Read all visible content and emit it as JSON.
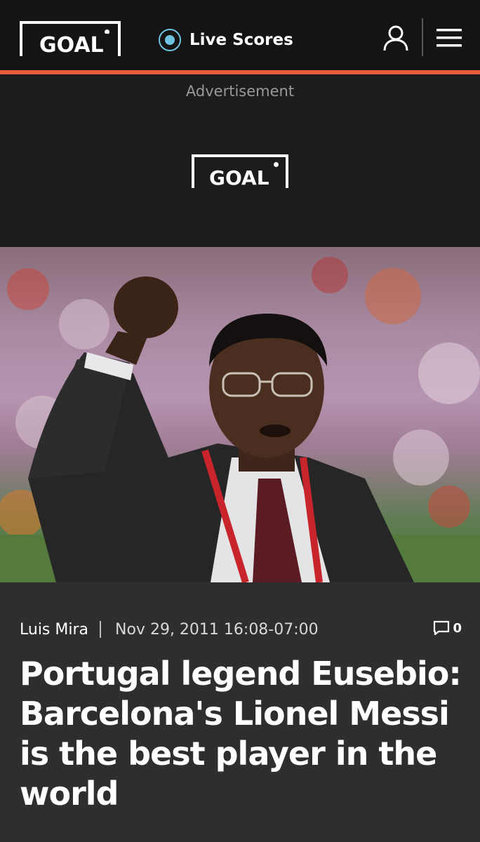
{
  "header": {
    "logo_text": "GOAL",
    "live_scores_label": "Live Scores",
    "user_icon": "user-icon",
    "menu_icon": "hamburger-menu-icon",
    "accent_color": "#e85d3b"
  },
  "advertisement": {
    "label": "Advertisement",
    "logo_text": "GOAL"
  },
  "hero": {
    "alt": "Eusebio raising his fist at a stadium"
  },
  "article": {
    "author": "Luis Mira",
    "date": "Nov 29, 2011 16:08-07:00",
    "comment_count": "0",
    "headline": "Portugal legend Eusebio: Barcelona's Lionel Messi is the best player in the world"
  }
}
